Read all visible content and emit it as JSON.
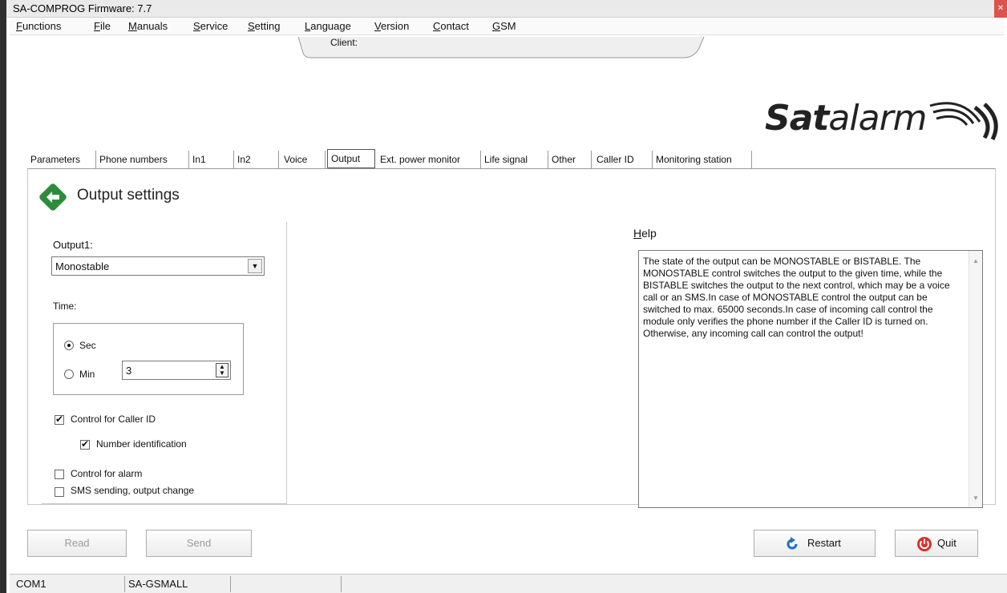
{
  "window": {
    "title": "SA-COMPROG Firmware: 7.7"
  },
  "menu": [
    "Functions",
    "File",
    "Manuals",
    "Service",
    "Setting",
    "Language",
    "Version",
    "Contact",
    "GSM"
  ],
  "client": {
    "label": "Client:"
  },
  "logo": {
    "text_bold": "Sat",
    "text_light": "alarm"
  },
  "tabs": [
    "Parameters",
    "Phone numbers",
    "In1",
    "In2",
    "Voice",
    "Output",
    "Ext. power monitor",
    "Life signal",
    "Other",
    "Caller ID",
    "Monitoring station"
  ],
  "active_tab": "Output",
  "section": {
    "title": "Output settings"
  },
  "output": {
    "label": "Output1:",
    "mode": "Monostable",
    "time_label": "Time:",
    "unit_sec": "Sec",
    "unit_min": "Min",
    "selected_unit": "Sec",
    "time_value": "3",
    "control_caller_id": {
      "label": "Control for Caller ID",
      "checked": true
    },
    "number_identification": {
      "label": "Number identification",
      "checked": true
    },
    "control_alarm": {
      "label": "Control for alarm",
      "checked": false
    },
    "sms_sending": {
      "label": "SMS sending, output change",
      "checked": false
    }
  },
  "help": {
    "label": "Help",
    "text": "The state of the output can be MONOSTABLE or BISTABLE. The MONOSTABLE control switches the output to the given time, while the BISTABLE switches the output to the next control, which may be a voice call or an SMS.In case of MONOSTABLE control the output can be switched to max. 65000 seconds.In case of incoming call control the module only verifies the phone number if the Caller ID is turned on. Otherwise, any incoming call can control the output!"
  },
  "buttons": {
    "read": "Read",
    "send": "Send",
    "restart": "Restart",
    "quit": "Quit"
  },
  "status": {
    "port": "COM1",
    "device": "SA-GSMALL",
    "field3": "",
    "field4": ""
  },
  "colors": {
    "back_icon": "#2e8b3a",
    "restart_icon": "#1f6fc5",
    "quit_icon": "#d9302c"
  }
}
